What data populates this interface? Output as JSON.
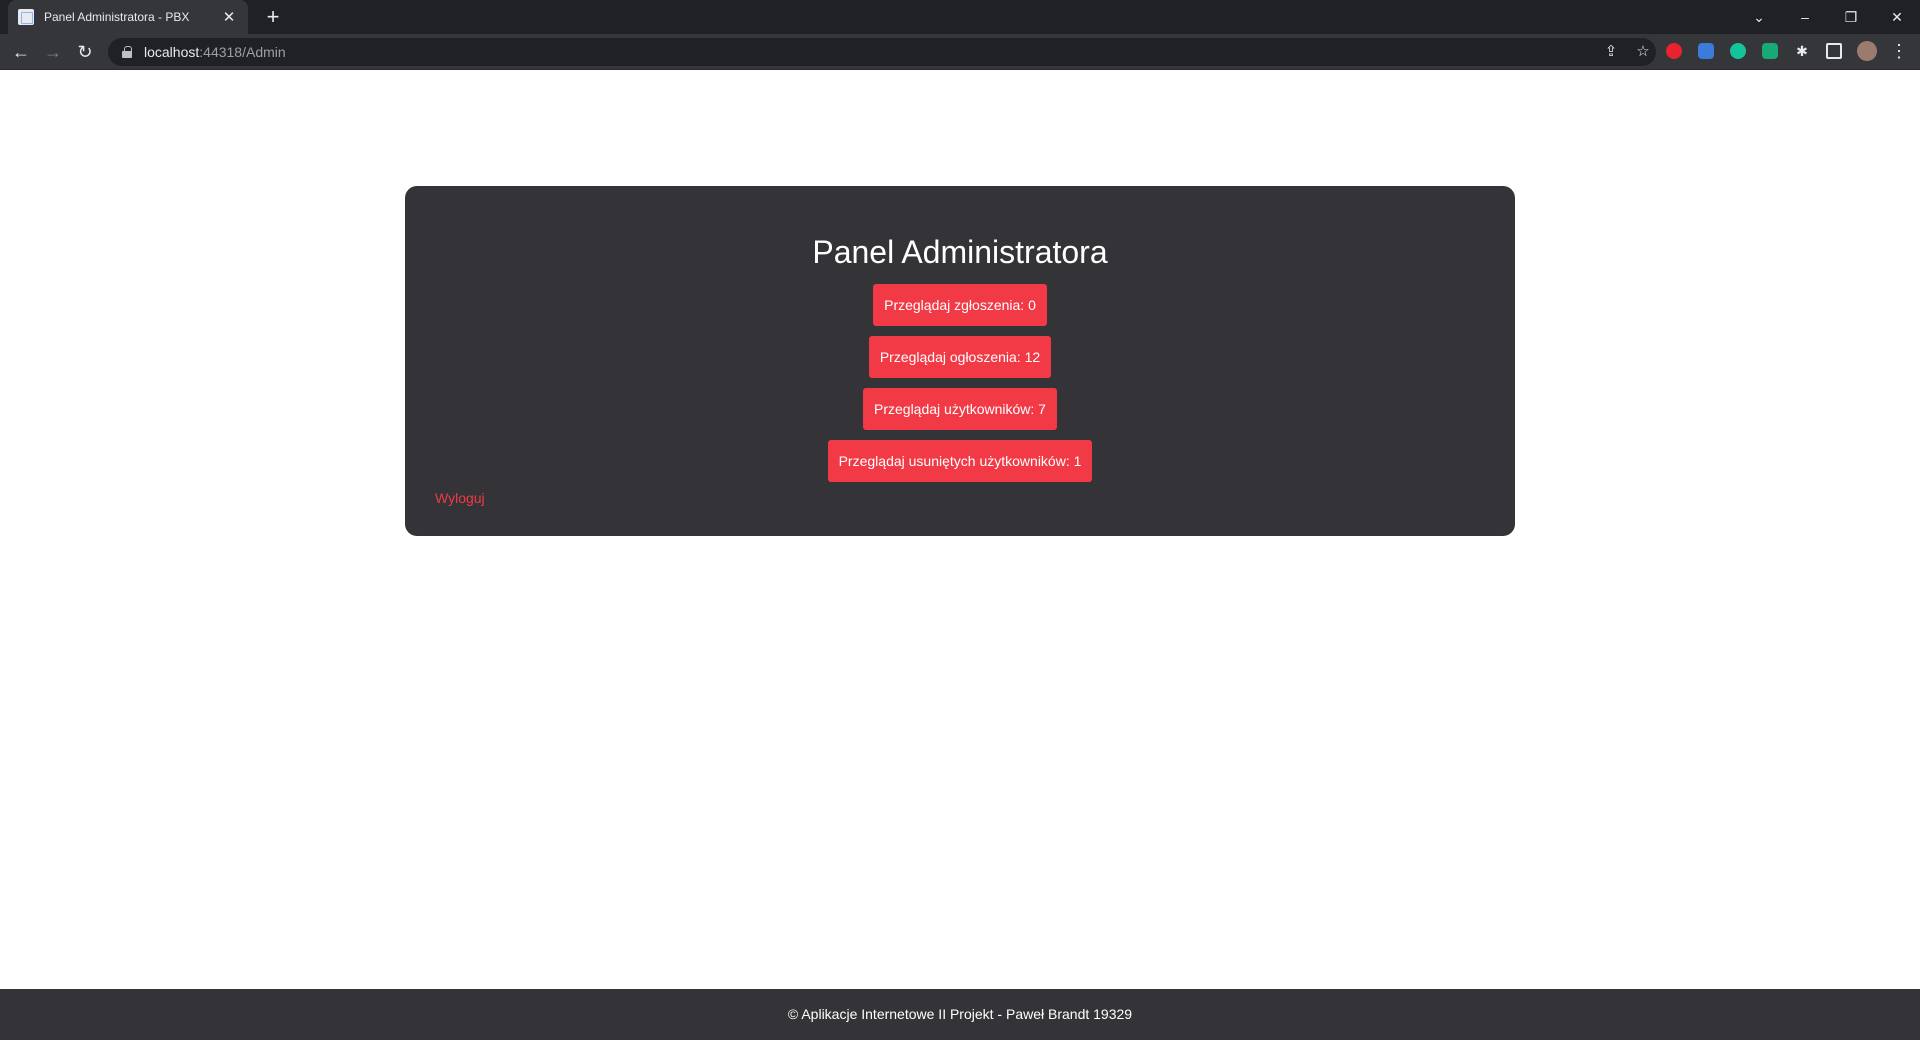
{
  "browser": {
    "tab_title": "Panel Administratora - PBX",
    "tab_close": "✕",
    "new_tab": "+",
    "url_host": "localhost",
    "url_rest": ":44318/Admin",
    "controls": {
      "chevron": "⌄",
      "minimize": "–",
      "restore": "❐",
      "close": "✕"
    },
    "nav": {
      "back": "←",
      "forward": "→",
      "reload": "↻"
    },
    "omnibox_icons": {
      "share": "⇪",
      "bookmark": "☆"
    },
    "extensions": [
      {
        "name": "adblock-extension-icon",
        "color": "#e8232f"
      },
      {
        "name": "cloud-extension-icon",
        "color": "#3b7bdc"
      },
      {
        "name": "grammarly-extension-icon",
        "color": "#15c39a"
      },
      {
        "name": "green-extension-icon",
        "color": "#19a974"
      },
      {
        "name": "puzzle-extensions-icon",
        "color": "#e8eaed"
      },
      {
        "name": "sidepanel-icon",
        "color": "#e8eaed"
      },
      {
        "name": "profile-avatar",
        "color": "#9a7b6e"
      }
    ],
    "menu": "⋮"
  },
  "panel": {
    "title": "Panel Administratora",
    "buttons": [
      "Przeglądaj zgłoszenia: 0",
      "Przeglądaj ogłoszenia: 12",
      "Przeglądaj użytkowników: 7",
      "Przeglądaj usuniętych użytkowników: 1"
    ],
    "logout": "Wyloguj"
  },
  "footer": {
    "text": "© Aplikacje Internetowe II Projekt - Paweł Brandt 19329"
  },
  "colors": {
    "accent": "#f23a46",
    "panel_bg": "#333338",
    "footer_bg": "#333338"
  }
}
